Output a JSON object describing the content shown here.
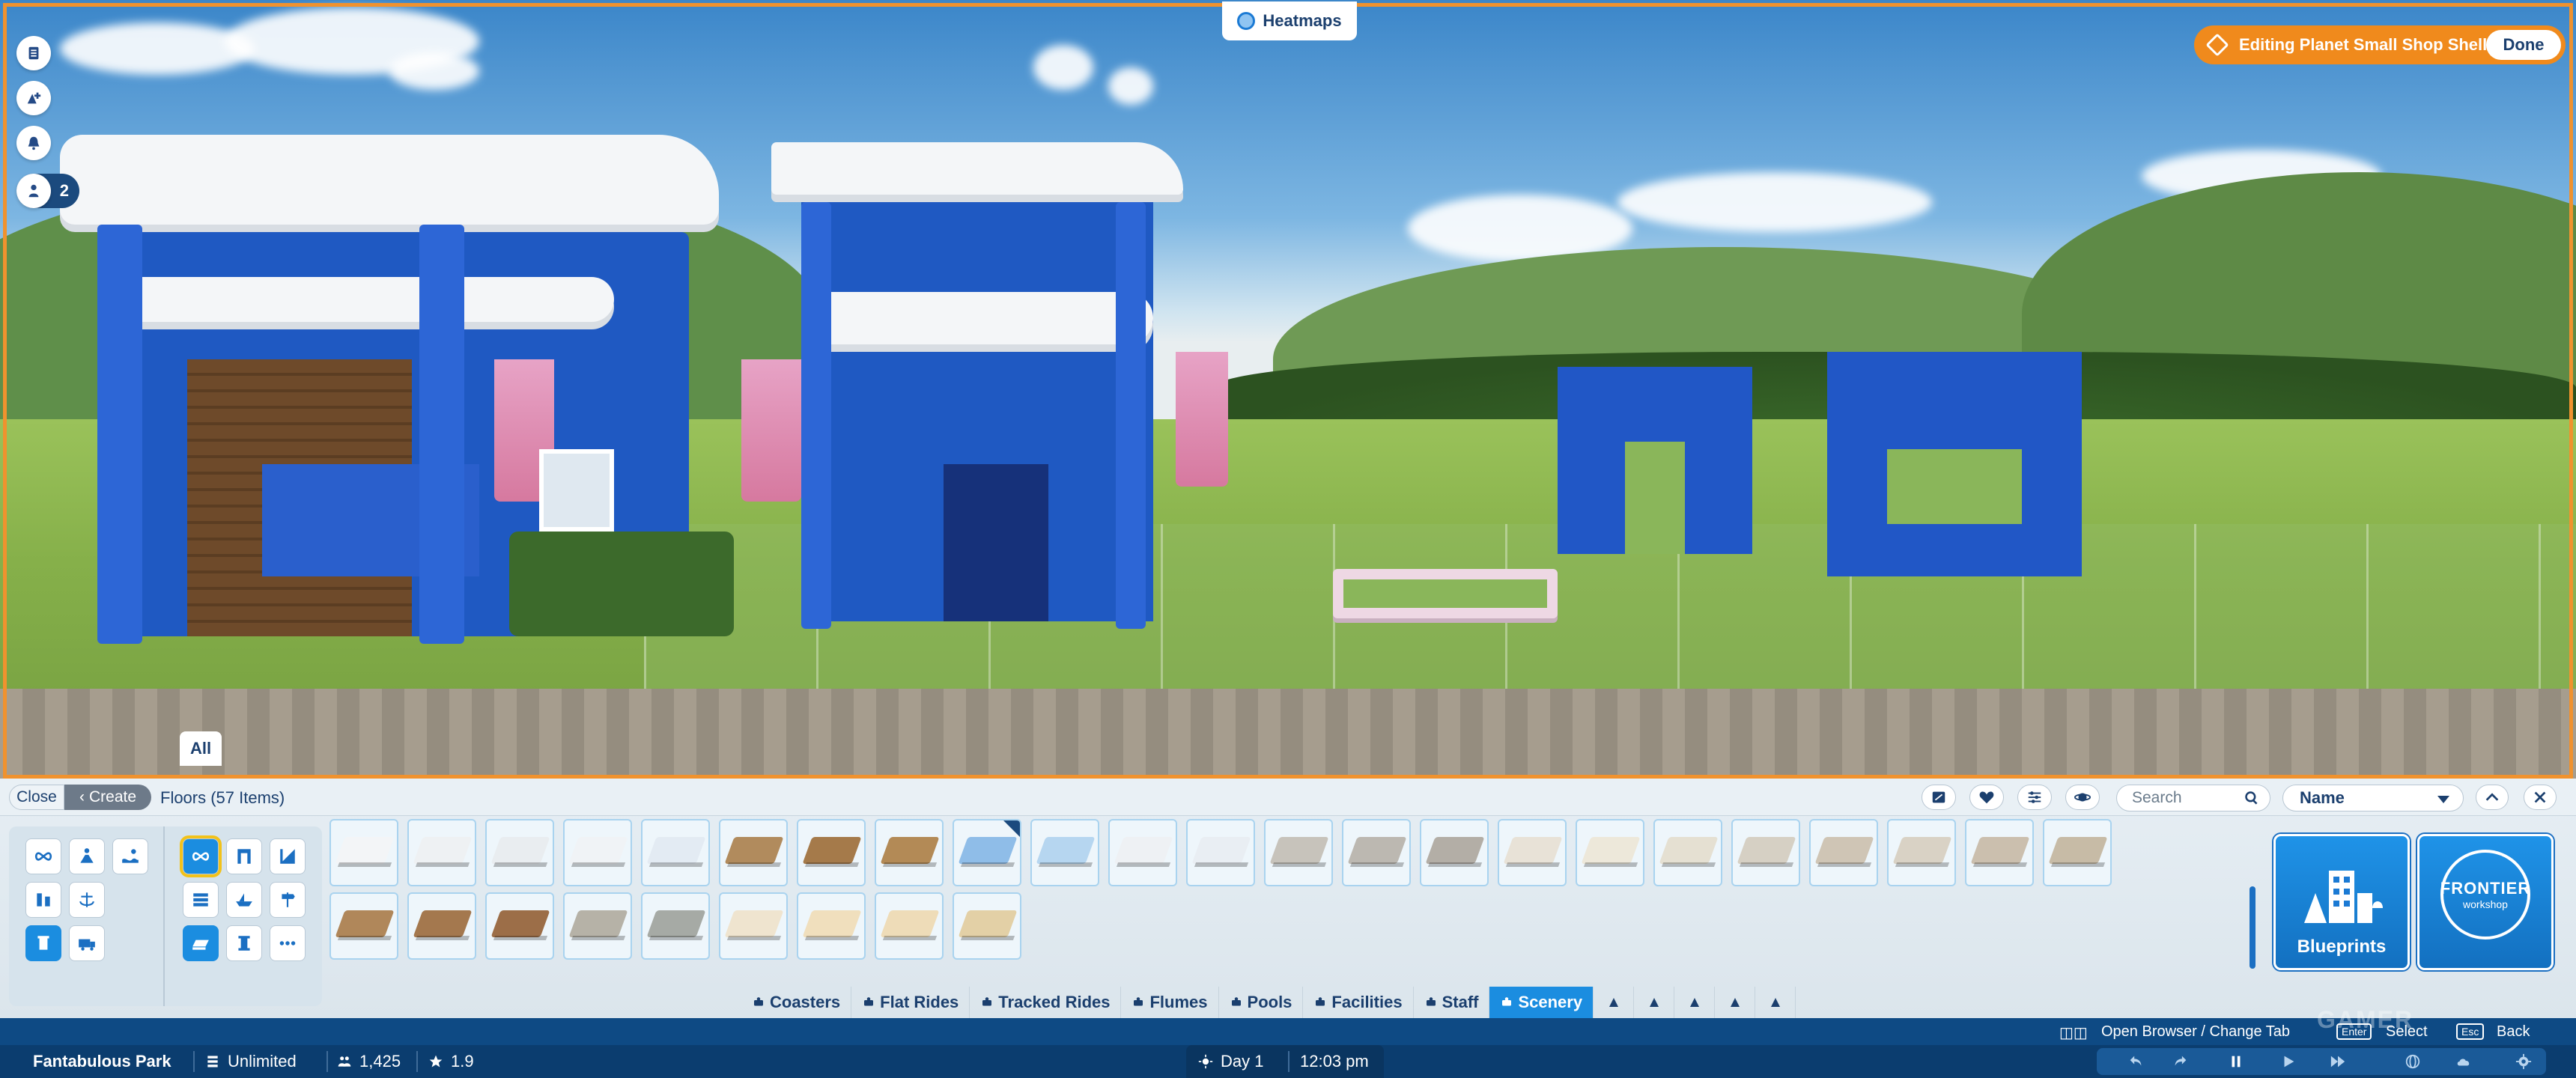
{
  "hud": {
    "heatmaps_label": "Heatmaps",
    "editing_label": "Editing Planet Small Shop Shell",
    "done_label": "Done",
    "guest_count": "2",
    "left_buttons": [
      "park-management-icon",
      "add-guest-icon",
      "notification-bell-icon",
      "guest-icon"
    ],
    "all_tab_label": "All"
  },
  "browser": {
    "close_label": "Close",
    "create_label": "Create",
    "section_title": "Floors (57 Items)",
    "search_placeholder": "Search",
    "sort_value": "Name",
    "toolbar_icons": [
      "blueprint-filter-icon",
      "favourite-heart-icon",
      "filter-sliders-icon",
      "planet-icon"
    ],
    "categories": [
      [
        "infinity-icon",
        "guest-pose-icon",
        "swimmer-icon"
      ],
      [
        "ride-icon",
        "anchor-icon"
      ],
      [
        "scenery-tower-icon",
        "truck-icon"
      ]
    ],
    "subcategories": [
      [
        "infinity-icon",
        "doorway-icon",
        "diagonal-icon"
      ],
      [
        "layers-icon",
        "boat-icon",
        "sign-icon"
      ],
      [
        "floor-icon",
        "column-icon",
        "more-icon"
      ]
    ],
    "tile_colors_row1": [
      "#f3f5f7",
      "#eef1f3",
      "#e9edf0",
      "#f0f3f6",
      "#e3ebf3",
      "#b18b5d",
      "#a57a4a",
      "#b38a56",
      "#8fbde8",
      "#b6d6f0",
      "#eef1f4",
      "#e9eef3",
      "#c7c3bb",
      "#bcb8b1",
      "#b3aea6",
      "#e8e2d7",
      "#ede8da",
      "#e5e0d2",
      "#d6d0c4",
      "#cfc5b5",
      "#d9d2c5",
      "#cbbfae",
      "#c7bba6"
    ],
    "tile_colors_row2": [
      "#b0875a",
      "#a4784e",
      "#9c6e48",
      "#b6b2a7",
      "#a6aaa5",
      "#efe4cf",
      "#f0dfbd",
      "#eedcb8",
      "#e3d0a6"
    ],
    "checked_tile_index": 8,
    "blueprints_label": "Blueprints",
    "workshop_brand": "FRONTIER",
    "workshop_sub": "workshop"
  },
  "tabs": [
    {
      "icon": "coaster-icon",
      "label": "Coasters"
    },
    {
      "icon": "flat-ride-icon",
      "label": "Flat Rides"
    },
    {
      "icon": "tracked-ride-icon",
      "label": "Tracked Rides"
    },
    {
      "icon": "flume-icon",
      "label": "Flumes"
    },
    {
      "icon": "pool-icon",
      "label": "Pools"
    },
    {
      "icon": "facility-icon",
      "label": "Facilities"
    },
    {
      "icon": "staff-icon",
      "label": "Staff"
    },
    {
      "icon": "scenery-icon",
      "label": "Scenery"
    }
  ],
  "tab_tools": [
    "building-icon",
    "terrain-icon",
    "landscape-icon",
    "blueprint-icon",
    "expand-icon"
  ],
  "hints": {
    "open_browser": "Open Browser / Change Tab",
    "enter_key": "Enter",
    "select": "Select",
    "esc_key": "Esc",
    "back": "Back"
  },
  "status": {
    "park_name": "Fantabulous Park",
    "money": "Unlimited",
    "guests": "1,425",
    "rating": "1.9",
    "day": "Day 1",
    "time": "12:03 pm"
  },
  "controls": [
    "undo-icon",
    "redo-icon",
    "pause-icon",
    "play-icon",
    "fast-forward-icon",
    "globe-icon",
    "weather-icon",
    "settings-gear-icon"
  ],
  "watermark": "GAMER"
}
